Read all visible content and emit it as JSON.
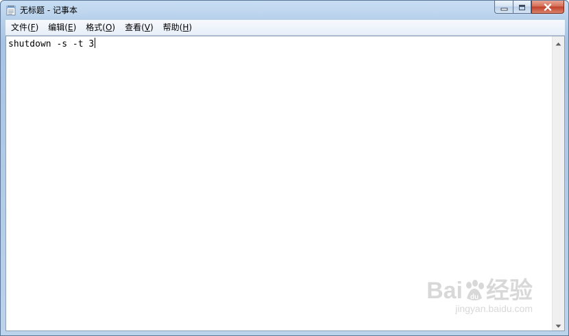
{
  "window": {
    "title": "无标题 - 记事本"
  },
  "menu": [
    {
      "label": "文件(",
      "accel": "F",
      "end": ")"
    },
    {
      "label": "编辑(",
      "accel": "E",
      "end": ")"
    },
    {
      "label": "格式(",
      "accel": "O",
      "end": ")"
    },
    {
      "label": "查看(",
      "accel": "V",
      "end": ")"
    },
    {
      "label": "帮助(",
      "accel": "H",
      "end": ")"
    }
  ],
  "editor": {
    "content": "shutdown -s -t 3"
  },
  "watermark": {
    "brand_left": "Bai",
    "brand_right": "经验",
    "url": "jingyan.baidu.com"
  },
  "icons": {
    "app": "notepad-icon",
    "minimize": "minimize-icon",
    "maximize": "maximize-icon",
    "close": "close-icon",
    "scroll_up": "scroll-up-arrow-icon",
    "scroll_down": "scroll-down-arrow-icon"
  }
}
